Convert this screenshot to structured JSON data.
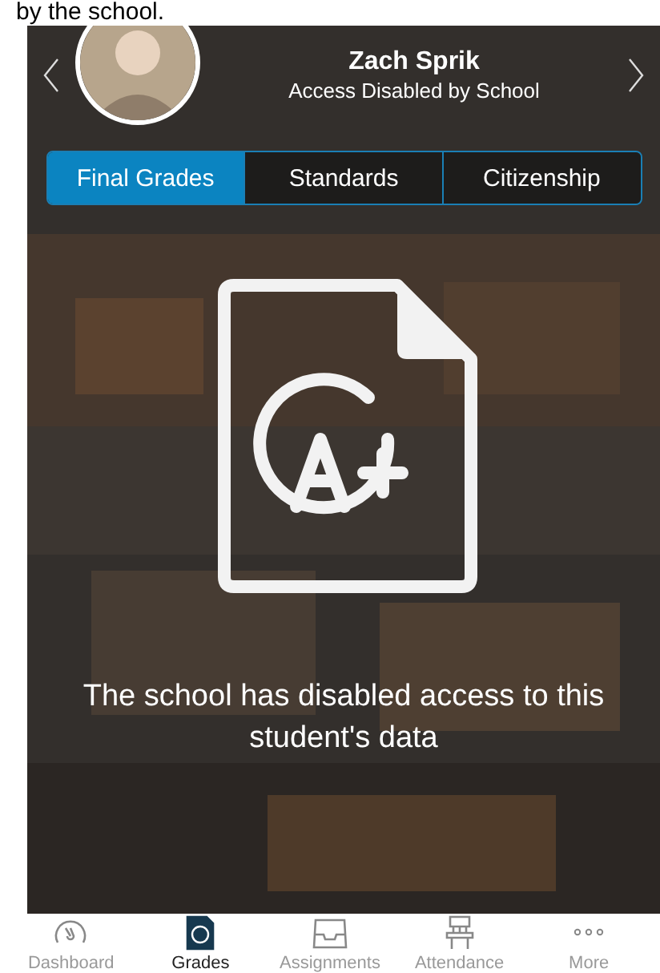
{
  "caption": "by the school.",
  "student": {
    "name": "Zach Sprik",
    "status": "Access Disabled by School"
  },
  "tabs": [
    {
      "label": "Final Grades",
      "selected": true
    },
    {
      "label": "Standards",
      "selected": false
    },
    {
      "label": "Citizenship",
      "selected": false
    }
  ],
  "message": "The school has disabled access to this student's data",
  "nav": [
    {
      "label": "Dashboard",
      "kind": "gauge",
      "selected": false
    },
    {
      "label": "Grades",
      "kind": "grades",
      "selected": true
    },
    {
      "label": "Assignments",
      "kind": "tray",
      "selected": false
    },
    {
      "label": "Attendance",
      "kind": "chair",
      "selected": false
    },
    {
      "label": "More",
      "kind": "more",
      "selected": false
    }
  ]
}
